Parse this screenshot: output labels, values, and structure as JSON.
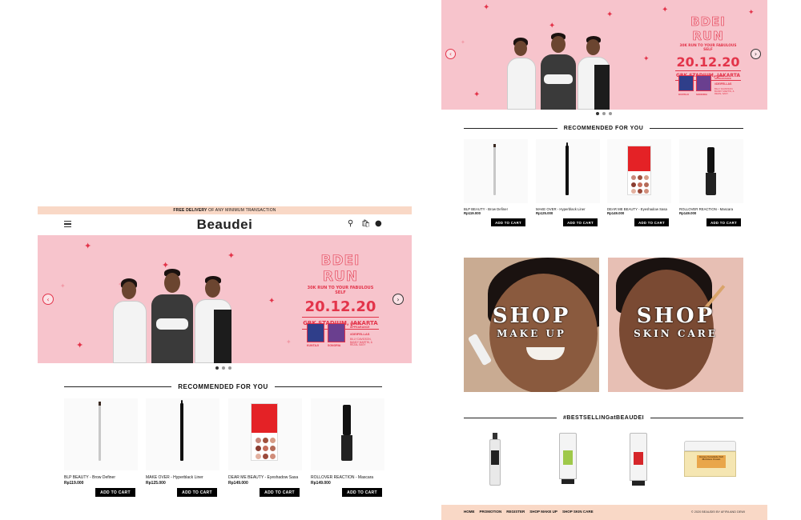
{
  "left": {
    "delivery_bar": {
      "bold": "FREE DELIVERY",
      "rest": " OF ANY MINIMUM TRANSACTION"
    },
    "logo": "Beaudei",
    "icons": [
      "menu-icon",
      "search-icon",
      "cart-icon",
      "user-icon"
    ]
  },
  "banner": {
    "title": "BDEI RUN",
    "subtitle": "30K RUN TO YOUR FABULOUS SELF",
    "date": "20.12.20",
    "venue": "GBK STADIUM, JAKARTA",
    "special_label": "SPECIAL APPEARANCE",
    "guests": "#DEIFELLAS",
    "guest_names": "BILLY DAVIDSON, BANDY MARTIN, & REZAL SASY",
    "thumb_a": "KUNTAJI",
    "thumb_b": "SONORIA"
  },
  "recommended": {
    "heading": "RECOMMENDED FOR YOU",
    "products": [
      {
        "name": "BLP BEAUTY - Brow Definer",
        "price": "Rp119.000",
        "button": "ADD TO CART",
        "kind": "brow"
      },
      {
        "name": "MAKE OVER - Hyperblack Liner",
        "price": "Rp125.000",
        "button": "ADD TO CART",
        "kind": "liner"
      },
      {
        "name": "DEAR ME BEAUTY - Eyeshadow Sasa",
        "price": "Rp149.000",
        "button": "ADD TO CART",
        "kind": "palette"
      },
      {
        "name": "ROLLOVER REACTION - Mascara",
        "price": "Rp149.000",
        "button": "ADD TO CART",
        "kind": "mascara"
      }
    ]
  },
  "right": {
    "promo_tiles": [
      {
        "title": "SHOP",
        "subtitle": "MAKE UP"
      },
      {
        "title": "SHOP",
        "subtitle": "SKIN CARE"
      }
    ],
    "bestselling_heading": "#BESTSELLINGatBEAUDEI",
    "bestsellers": [
      {
        "label": "",
        "kind": "toner"
      },
      {
        "label": "",
        "kind": "tube-green"
      },
      {
        "label": "",
        "kind": "tube-red"
      },
      {
        "label": "Honey Ceramide Full Moisture Cream",
        "kind": "jar"
      }
    ],
    "footer": {
      "links": [
        "HOME",
        "PROMOTION",
        "REGISTER",
        "SHOP MAKE UP",
        "SHOP SKIN CARE"
      ],
      "copyright": "© 2020 BEAUDEI BY AFIFA AND DEWI"
    }
  },
  "colors": {
    "banner_pink": "#f7c4cc",
    "accent_red": "#e3344a",
    "peach_bar": "#f9d8c6",
    "button_black": "#000000"
  }
}
